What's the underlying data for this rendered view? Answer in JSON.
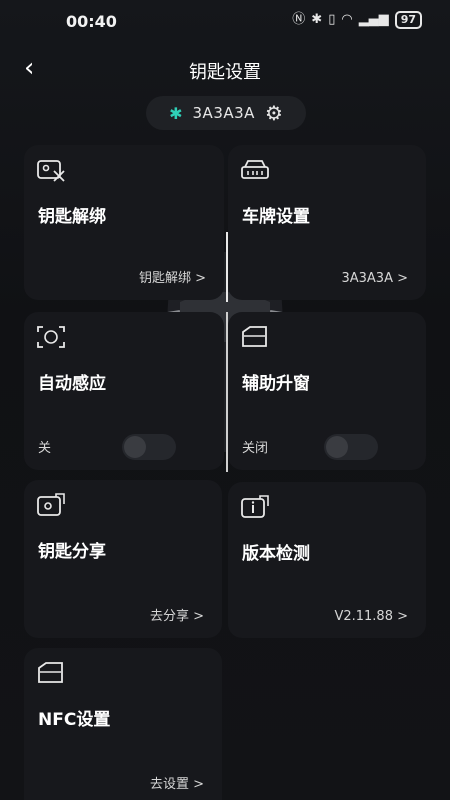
{
  "status": {
    "time": "00:40",
    "battery": "97"
  },
  "header": {
    "title": "钥匙设置"
  },
  "device": {
    "name": "3A3A3A"
  },
  "cards": {
    "key_unbind": {
      "title": "钥匙解绑",
      "action": "钥匙解绑 >"
    },
    "plate": {
      "title": "车牌设置",
      "value": "3A3A3A >"
    },
    "auto_sense": {
      "title": "自动感应",
      "state": "关",
      "enabled": false
    },
    "window": {
      "title": "辅助升窗",
      "state": "关闭",
      "enabled": false
    },
    "share": {
      "title": "钥匙分享",
      "action": "去分享 >"
    },
    "version": {
      "title": "版本检测",
      "value": "V2.11.88 >"
    },
    "nfc": {
      "title": "NFC设置",
      "action": "去设置 >"
    }
  },
  "colors": {
    "accent": "#2fd0b7",
    "card": "#17181c",
    "background": "#101114"
  },
  "icons": {
    "back": "chevron-left-icon",
    "bluetooth": "bluetooth-icon",
    "settings": "gear-icon"
  }
}
